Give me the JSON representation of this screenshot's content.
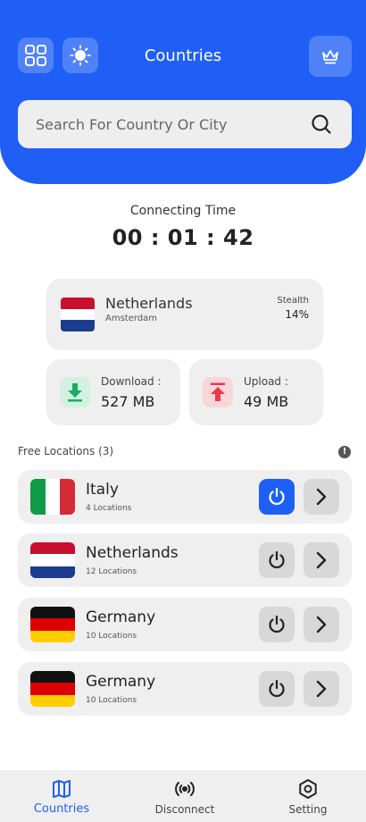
{
  "header": {
    "title": "Countries",
    "search_placeholder": "Search For Country Or City"
  },
  "connection": {
    "label": "Connecting Time",
    "time": "00 : 01 : 42"
  },
  "server": {
    "country": "Netherlands",
    "city": "Amsterdam",
    "stealth_label": "Stealth",
    "stealth_value": "14%"
  },
  "stats": {
    "download_label": "Download :",
    "download_value": "527 MB",
    "upload_label": "Upload :",
    "upload_value": "49 MB"
  },
  "locations": {
    "title": "Free Locations (3)",
    "items": [
      {
        "name": "Italy",
        "sub": "4 Locations",
        "flag": "italy",
        "active": true
      },
      {
        "name": "Netherlands",
        "sub": "12 Locations",
        "flag": "netherlands",
        "active": false
      },
      {
        "name": "Germany",
        "sub": "10 Locations",
        "flag": "germany",
        "active": false
      },
      {
        "name": "Germany",
        "sub": "10 Locations",
        "flag": "germany",
        "active": false
      }
    ]
  },
  "nav": {
    "items": [
      {
        "label": "Countries",
        "icon": "map-icon",
        "active": true
      },
      {
        "label": "Disconnect",
        "icon": "broadcast-icon",
        "active": false
      },
      {
        "label": "Setting",
        "icon": "settings-icon",
        "active": false
      }
    ]
  },
  "colors": {
    "accent": "#1f5ff5",
    "card": "#efefef",
    "download": "#1eaa62",
    "upload": "#e83a4b"
  }
}
